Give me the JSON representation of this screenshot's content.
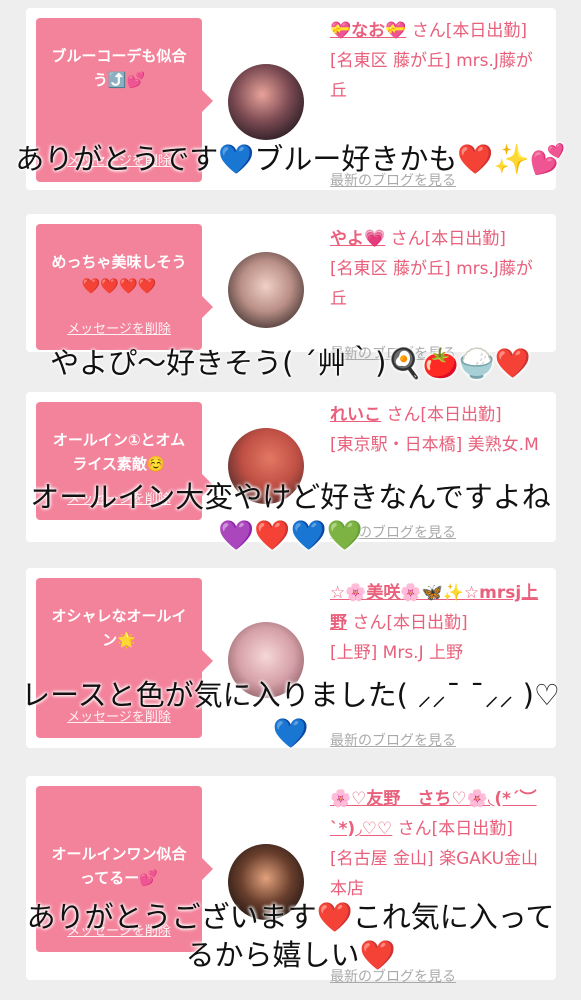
{
  "cards": [
    {
      "message": "ブルーコーデも似合う⤴️💕",
      "delete_label": "メッセージを削除",
      "name": "💝なお💝",
      "san_label": "さん[本日出勤]",
      "area": "[名東区 藤が丘] mrs.J藤が丘",
      "blog_label": "最新のブログを見る",
      "overlay": "ありがとうです💙ブルー好きかも❤️✨💕"
    },
    {
      "message": "めっちゃ美味しそう❤️❤️❤️❤️",
      "delete_label": "メッセージを削除",
      "name": "やよ💗",
      "san_label": "さん[本日出勤]",
      "area": "[名東区 藤が丘] mrs.J藤が丘",
      "blog_label": "最新のブログを見る",
      "overlay": "やよぴ〜好きそう( ´艸｀)🍳🍅🍚❤️"
    },
    {
      "message": "オールイン①とオムライス素敵☺️",
      "delete_label": "メッセージを削除",
      "name": "れいこ",
      "san_label": "さん[本日出勤]",
      "area": "[東京駅・日本橋] 美熟女.M",
      "blog_label": "最新のブログを見る",
      "overlay": "オールイン大変やけど好きなんですよね💜❤️💙💚"
    },
    {
      "message": "オシャレなオールイン🌟",
      "delete_label": "メッセージを削除",
      "name": "☆🌸美咲🌸🦋✨☆mrsj上野",
      "san_label": "さん[本日出勤]",
      "area": "[上野] Mrs.J 上野",
      "blog_label": "最新のブログを見る",
      "overlay": "レースと色が気に入りました( ⸝⸝¯ ¯⸝⸝ )♡💙"
    },
    {
      "message": "オールインワン似合ってるー💕",
      "delete_label": "メッセージを削除",
      "name": "🌸♡友野　さち♡🌸◟(*´︶`*)◞♡♡",
      "san_label": "さん[本日出勤]",
      "area": "[名古屋 金山] 楽GAKU金山本店",
      "blog_label": "最新のブログを見る",
      "overlay": "ありがとうございます❤️これ気に入ってるから嬉しい❤️"
    }
  ],
  "colors": {
    "accent": "#f3839b",
    "link": "#e8607b",
    "muted": "#aaaaaa"
  }
}
